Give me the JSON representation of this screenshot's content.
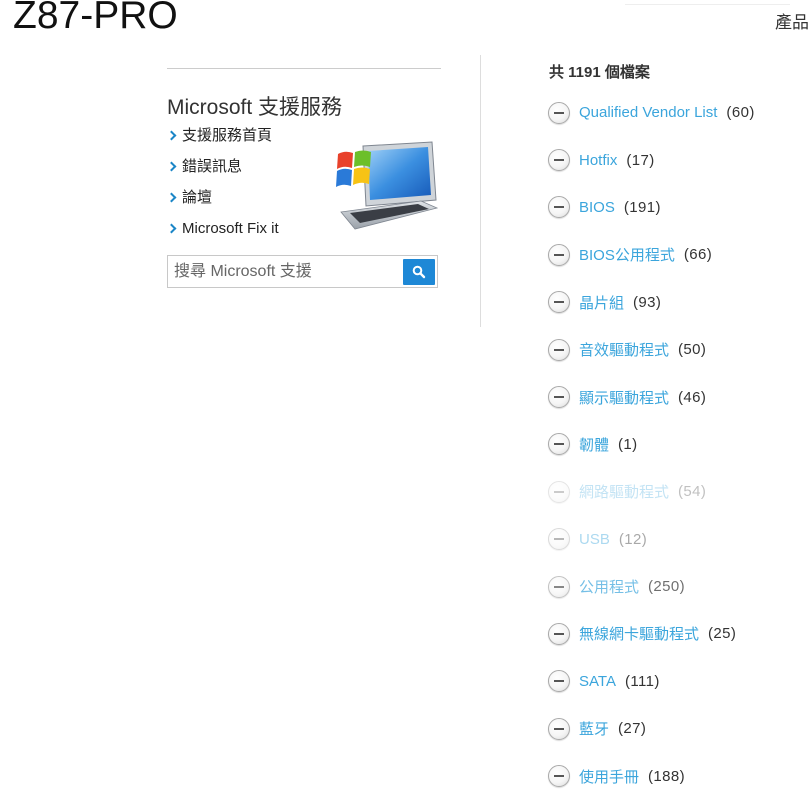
{
  "page": {
    "product_title": "Z87-PRO",
    "nav_products": "產品"
  },
  "support": {
    "heading": "Microsoft 支援服務",
    "links": [
      "支援服務首頁",
      "錯誤訊息",
      "論壇",
      "Microsoft Fix it"
    ],
    "search_placeholder": "搜尋 Microsoft 支援",
    "search_button_icon": "search-icon",
    "promo_image": "windows-laptop-illustration"
  },
  "downloads": {
    "total_label": "共 1191 個檔案",
    "expand_icon": "circle-minus-icon",
    "categories": [
      {
        "label": "Qualified Vendor List",
        "count": 60
      },
      {
        "label": "Hotfix",
        "count": 17
      },
      {
        "label": "BIOS",
        "count": 191
      },
      {
        "label": "BIOS公用程式",
        "count": 66
      },
      {
        "label": "晶片組",
        "count": 93
      },
      {
        "label": "音效驅動程式",
        "count": 50
      },
      {
        "label": "顯示驅動程式",
        "count": 46
      },
      {
        "label": "韌體",
        "count": 1
      },
      {
        "label": "網路驅動程式",
        "count": 54
      },
      {
        "label": "USB",
        "count": 12
      },
      {
        "label": "公用程式",
        "count": 250
      },
      {
        "label": "無線網卡驅動程式",
        "count": 25
      },
      {
        "label": "SATA",
        "count": 111
      },
      {
        "label": "藍牙",
        "count": 27
      },
      {
        "label": "使用手冊",
        "count": 188
      }
    ]
  },
  "colors": {
    "link": "#3ba5dc",
    "chevron": "#1b86c7",
    "search_button": "#1e88d6",
    "text": "#333333"
  }
}
